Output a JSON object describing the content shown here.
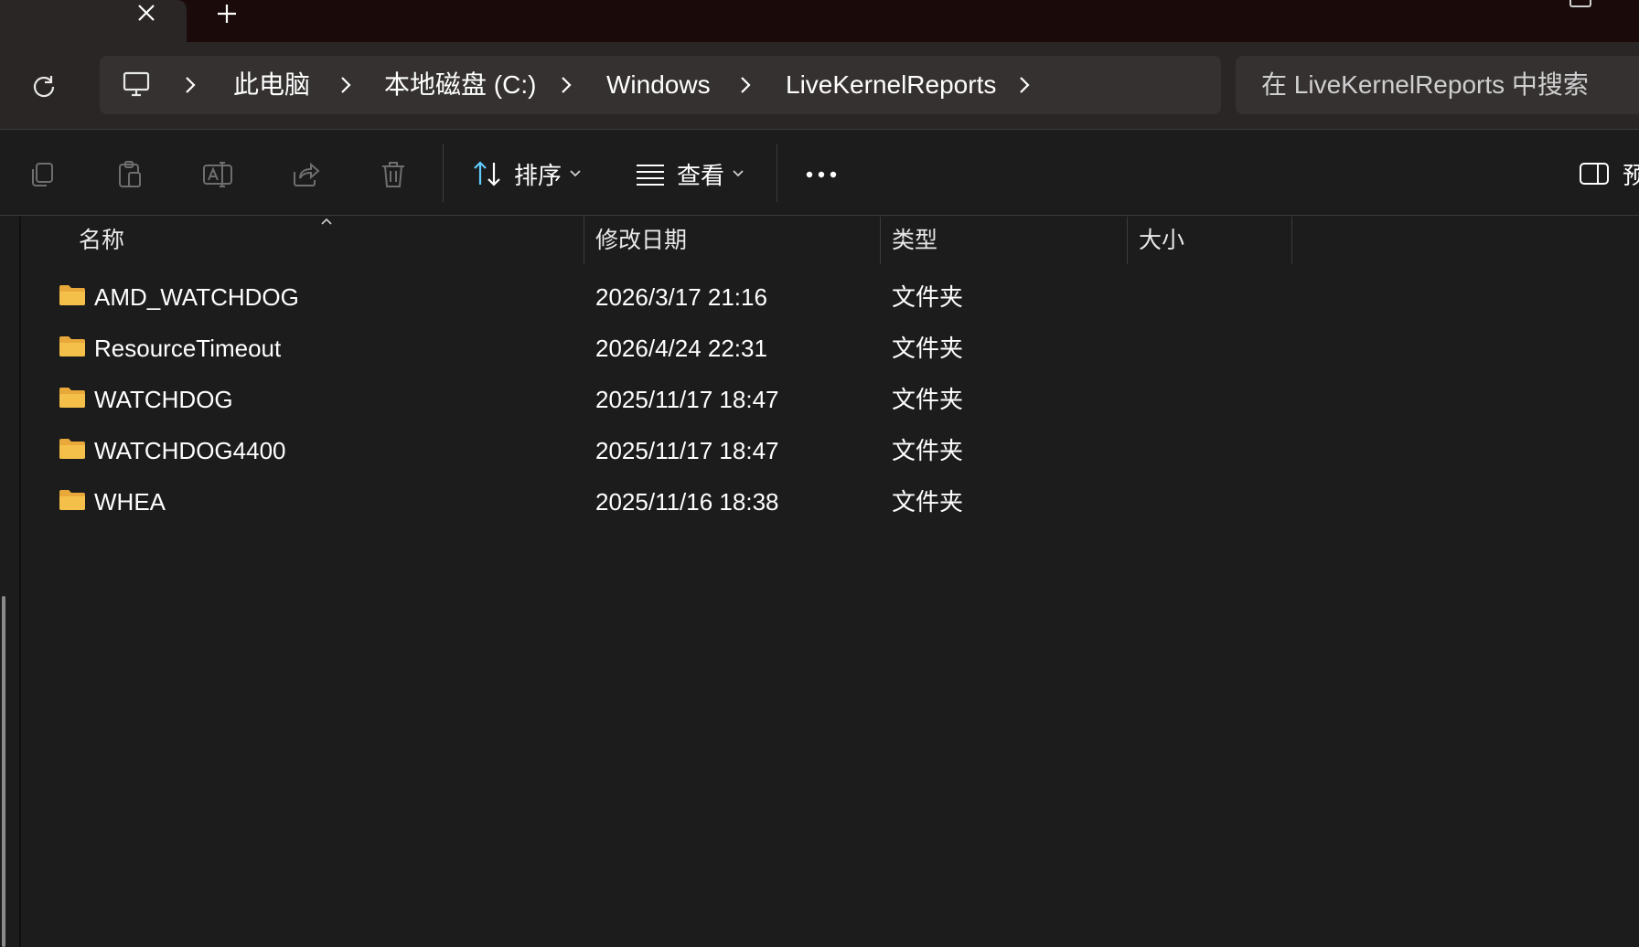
{
  "tabs": {
    "close_icon": "close-icon",
    "new_tab_icon": "plus-icon"
  },
  "address": {
    "refresh_icon": "refresh-icon",
    "pc_icon": "computer-icon",
    "breadcrumbs": [
      "此电脑",
      "本地磁盘 (C:)",
      "Windows",
      "LiveKernelReports"
    ],
    "search_placeholder": "在 LiveKernelReports 中搜索"
  },
  "toolbar": {
    "copy_icon": "copy-icon",
    "paste_icon": "paste-icon",
    "rename_icon": "rename-icon",
    "share_icon": "share-icon",
    "delete_icon": "delete-icon",
    "sort_label": "排序",
    "view_label": "查看",
    "more_icon": "more-icon",
    "preview_label": "预"
  },
  "columns": {
    "name": "名称",
    "modified": "修改日期",
    "type": "类型",
    "size": "大小"
  },
  "files": [
    {
      "name": "AMD_WATCHDOG",
      "modified": "2026/3/17 21:16",
      "type": "文件夹",
      "size": ""
    },
    {
      "name": "ResourceTimeout",
      "modified": "2026/4/24 22:31",
      "type": "文件夹",
      "size": ""
    },
    {
      "name": "WATCHDOG",
      "modified": "2025/11/17 18:47",
      "type": "文件夹",
      "size": ""
    },
    {
      "name": "WATCHDOG4400",
      "modified": "2025/11/17 18:47",
      "type": "文件夹",
      "size": ""
    },
    {
      "name": "WHEA",
      "modified": "2025/11/16 18:38",
      "type": "文件夹",
      "size": ""
    }
  ],
  "colors": {
    "accent": "#60cdff",
    "folder": "#f5c04a"
  }
}
